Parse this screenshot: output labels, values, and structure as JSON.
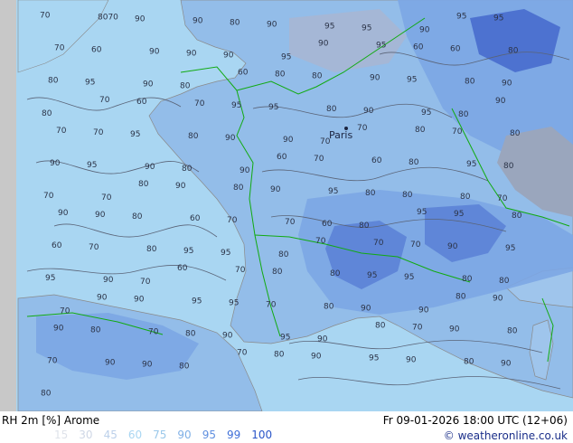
{
  "map": {
    "title": "RH 2m [%] Arome",
    "datetime": "Fr 09-01-2026 18:00 UTC (12+06)",
    "city": "Paris",
    "credit": "© weatheronline.co.uk",
    "legend": {
      "values": [
        "15",
        "30",
        "45",
        "60",
        "75",
        "90",
        "95",
        "99",
        "100"
      ],
      "colors": [
        "#dfe3ea",
        "#cfd7e6",
        "#bcd0ea",
        "#a9d6f2",
        "#9ac8ea",
        "#7fb0e6",
        "#5f8fe0",
        "#3f6fd8",
        "#2a55c8"
      ]
    },
    "colors": {
      "sea": "#a9d6f2",
      "land_humid": "#93bde9",
      "land_wet": "#7ca6e4",
      "land_very_wet": "#5f86d8",
      "land_saturated": "#4d72d0",
      "coast": "#8a8a8a",
      "border": "#11aa11",
      "isoline": "#5a6478",
      "label": "#2c3448",
      "outside": "#c8c8c8"
    },
    "contour_labels": [
      "70",
      "8070",
      "90",
      "90",
      "80",
      "90",
      "95",
      "95",
      "90",
      "95",
      "95",
      "70",
      "60",
      "90",
      "90",
      "90",
      "95",
      "90",
      "95",
      "60",
      "60",
      "80",
      "80",
      "95",
      "90",
      "80",
      "60",
      "80",
      "80",
      "90",
      "95",
      "80",
      "90",
      "80",
      "70",
      "60",
      "70",
      "95",
      "95",
      "80",
      "90",
      "95",
      "80",
      "90",
      "70",
      "70",
      "95",
      "80",
      "90",
      "90",
      "70",
      "70",
      "80",
      "70",
      "80",
      "90",
      "95",
      "90",
      "80",
      "90",
      "60",
      "70",
      "60",
      "80",
      "95",
      "80",
      "70",
      "70",
      "80",
      "90",
      "80",
      "90",
      "95",
      "80",
      "80",
      "80",
      "70",
      "90",
      "90",
      "80",
      "60",
      "70",
      "70",
      "60",
      "80",
      "95",
      "95",
      "80",
      "60",
      "70",
      "80",
      "95",
      "95",
      "80",
      "70",
      "70",
      "70",
      "90",
      "95",
      "95",
      "90",
      "70",
      "60",
      "70",
      "80",
      "80",
      "95",
      "95",
      "80",
      "80",
      "70",
      "90",
      "90",
      "95",
      "95",
      "70",
      "80",
      "90",
      "90",
      "80",
      "90",
      "90",
      "80",
      "70",
      "80",
      "90",
      "95",
      "90",
      "80",
      "70",
      "90",
      "80",
      "70",
      "90",
      "90",
      "80",
      "70",
      "80",
      "90",
      "95",
      "90",
      "80",
      "90",
      "80"
    ]
  }
}
